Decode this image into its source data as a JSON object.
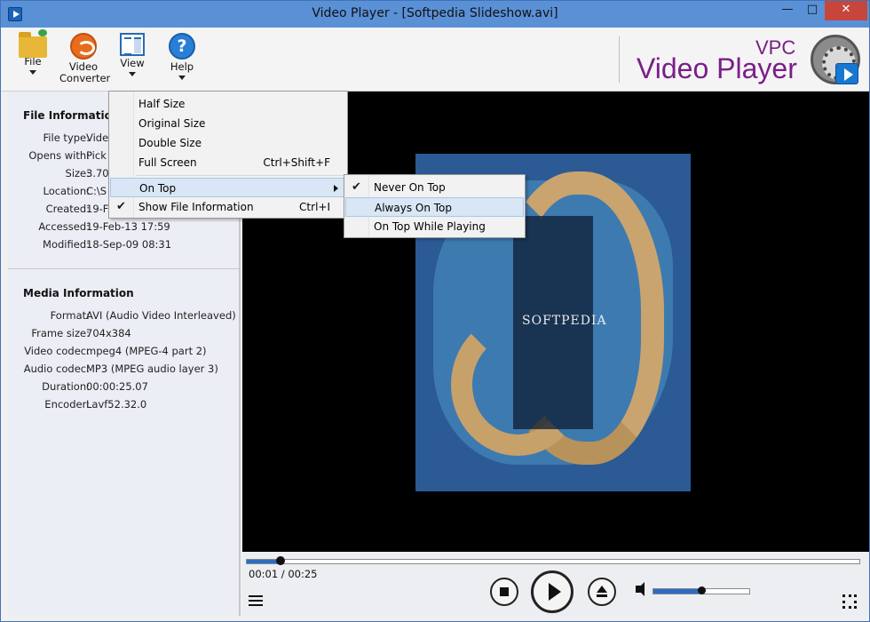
{
  "window": {
    "title": "Video Player - [Softpedia Slideshow.avi]",
    "min_glyph": "—",
    "max_glyph": "□",
    "close_glyph": "✕"
  },
  "toolbar": {
    "file_label": "File",
    "converter_label_1": "Video",
    "converter_label_2": "Converter",
    "view_label": "View",
    "help_label": "Help",
    "help_glyph": "?"
  },
  "brand": {
    "vpc": "VPC",
    "name": "Video Player"
  },
  "file_info": {
    "title": "File Information",
    "rows": [
      {
        "k": "File type:",
        "v": "Video"
      },
      {
        "k": "Opens with:",
        "v": "Pick"
      },
      {
        "k": "Size:",
        "v": "3.70"
      },
      {
        "k": "Location:",
        "v": "C:\\S"
      },
      {
        "k": "Created:",
        "v": "19-Fe"
      },
      {
        "k": "Accessed:",
        "v": "19-Feb-13 17:59"
      },
      {
        "k": "Modified:",
        "v": "18-Sep-09 08:31"
      }
    ]
  },
  "media_info": {
    "title": "Media Information",
    "rows": [
      {
        "k": "Format:",
        "v": "AVI (Audio Video Interleaved)"
      },
      {
        "k": "Frame size:",
        "v": "704x384"
      },
      {
        "k": "Video codec:",
        "v": "mpeg4 (MPEG-4 part 2)"
      },
      {
        "k": "Audio codec:",
        "v": "MP3 (MPEG audio layer 3)"
      },
      {
        "k": "Duration:",
        "v": "00:00:25.07"
      },
      {
        "k": "Encoder:",
        "v": "Lavf52.32.0"
      }
    ]
  },
  "video": {
    "watermark": "SOFTPEDIA"
  },
  "playback": {
    "time": "00:01 / 00:25",
    "progress_fraction": 0.055,
    "volume_fraction": 0.5
  },
  "view_menu": {
    "items": [
      {
        "label": "Half Size",
        "shortcut": ""
      },
      {
        "label": "Original Size",
        "shortcut": ""
      },
      {
        "label": "Double Size",
        "shortcut": ""
      },
      {
        "label": "Full Screen",
        "shortcut": "Ctrl+Shift+F"
      },
      {
        "label": "On Top",
        "shortcut": ""
      },
      {
        "label": "Show File Information",
        "shortcut": "Ctrl+I",
        "checked": true
      }
    ]
  },
  "ontop_menu": {
    "items": [
      {
        "label": "Never On Top",
        "checked": true
      },
      {
        "label": "Always On Top",
        "checked": false
      },
      {
        "label": "On Top While Playing",
        "checked": false
      }
    ]
  },
  "colors": {
    "brand": "#7a1e88",
    "accent": "#2b6dc2",
    "titlebar": "#5a90d6",
    "close": "#c7463c"
  }
}
